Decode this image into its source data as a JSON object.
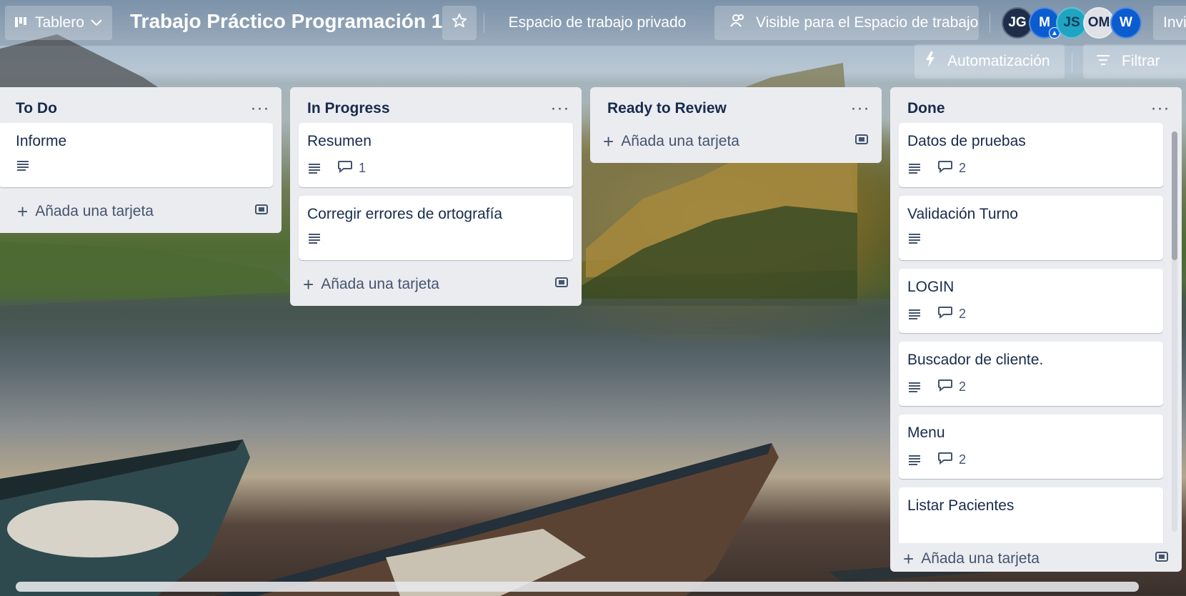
{
  "header": {
    "view_label": "Tablero",
    "board_title": "Trabajo Práctico Programación 1",
    "workspace_label": "Espacio de trabajo privado",
    "visibility_label": "Visible para el Espacio de trabajo",
    "invite_label": "Invi",
    "automation_label": "Automatización",
    "filter_label": "Filtrar",
    "members": [
      {
        "initials": "JG",
        "color": "#1d2d4a"
      },
      {
        "initials": "M",
        "color": "#0b5ccf"
      },
      {
        "initials": "JS",
        "color": "#1fa5c1"
      },
      {
        "initials": "OM",
        "color": "#dfe1e6"
      },
      {
        "initials": "W",
        "color": "#0b5ccf"
      }
    ]
  },
  "lists": {
    "todo": {
      "title": "To Do",
      "cards": [
        {
          "title": "Informe"
        }
      ],
      "add_label": "Añada una tarjeta"
    },
    "inprogress": {
      "title": "In Progress",
      "cards": [
        {
          "title": "Resumen",
          "comments": "1"
        },
        {
          "title": "Corregir errores de ortografía"
        }
      ],
      "add_label": "Añada una tarjeta"
    },
    "review": {
      "title": "Ready to Review",
      "add_label": "Añada una tarjeta"
    },
    "done": {
      "title": "Done",
      "cards": [
        {
          "title": "Datos de pruebas",
          "comments": "2"
        },
        {
          "title": "Validación Turno"
        },
        {
          "title": "LOGIN",
          "comments": "2"
        },
        {
          "title": "Buscador de cliente.",
          "comments": "2"
        },
        {
          "title": "Menu",
          "comments": "2"
        },
        {
          "title": "Listar Pacientes"
        }
      ],
      "add_label": "Añada una tarjeta"
    }
  },
  "icons": {
    "description": "description-icon",
    "comment": "comment-icon",
    "template": "card-template-icon",
    "add": "plus-icon",
    "menu": "more-icon"
  }
}
